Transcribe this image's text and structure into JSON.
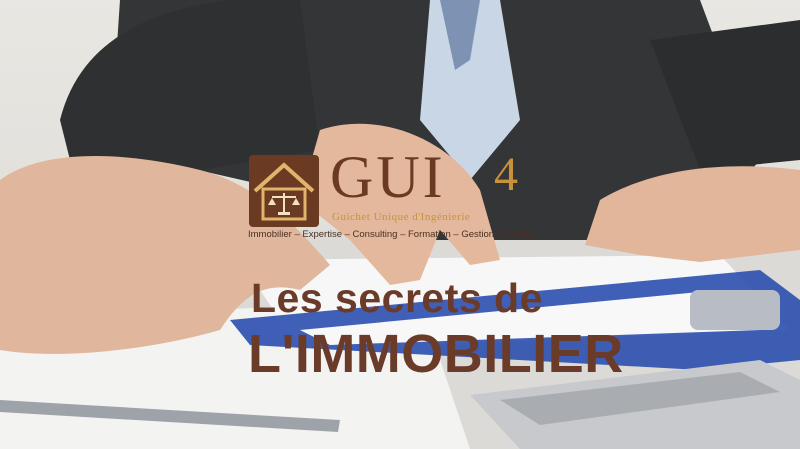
{
  "logo": {
    "name": "GUI",
    "number": "4",
    "tagline": "Guichet Unique d'Ingénierie",
    "services": "Immobilier – Expertise – Consulting – Formation – Gestion de projet",
    "icon": "scales-of-justice-house-icon"
  },
  "headline": {
    "line1": "Les secrets de",
    "line2": "L'IMMOBILIER"
  },
  "colors": {
    "brand_brown": "#6a3b22",
    "brand_gold": "#c8923c",
    "headline": "#6b3b2a"
  }
}
